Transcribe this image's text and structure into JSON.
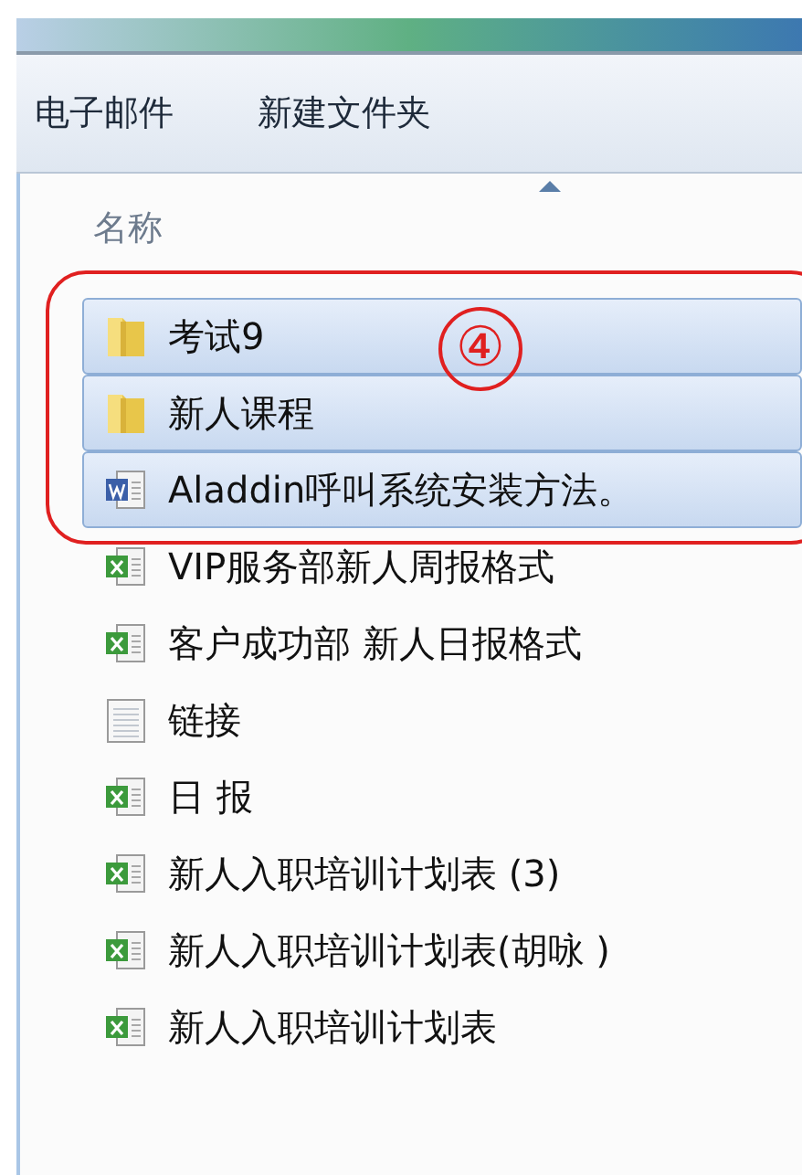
{
  "toolbar": {
    "buttons": [
      "电子邮件",
      "新建文件夹"
    ]
  },
  "column_header": {
    "label": "名称"
  },
  "annotation": {
    "label": "④"
  },
  "files": [
    {
      "name": "考试9",
      "kind": "folder",
      "selected": true
    },
    {
      "name": "新人课程",
      "kind": "folder",
      "selected": true
    },
    {
      "name": "Aladdin呼叫系统安装方法。",
      "kind": "word",
      "selected": true
    },
    {
      "name": "VIP服务部新人周报格式",
      "kind": "excel",
      "selected": false
    },
    {
      "name": "客户成功部 新人日报格式",
      "kind": "excel",
      "selected": false
    },
    {
      "name": "链接",
      "kind": "text",
      "selected": false
    },
    {
      "name": "日 报",
      "kind": "excel",
      "selected": false
    },
    {
      "name": "新人入职培训计划表 (3)",
      "kind": "excel",
      "selected": false
    },
    {
      "name": "新人入职培训计划表(胡咏 )",
      "kind": "excel",
      "selected": false
    },
    {
      "name": "新人入职培训计划表",
      "kind": "excel",
      "selected": false
    }
  ]
}
